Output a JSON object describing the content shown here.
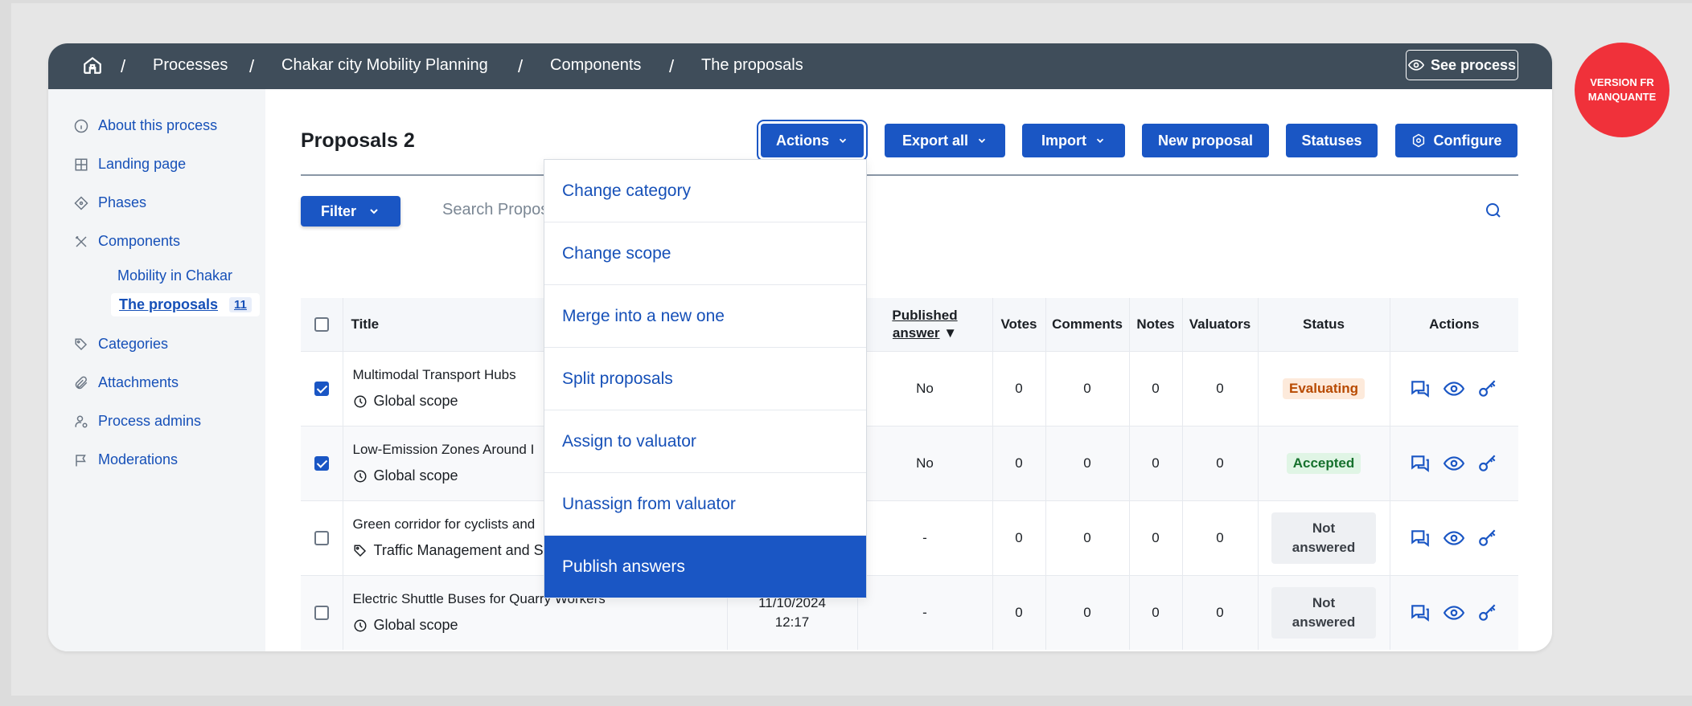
{
  "breadcrumb": {
    "items": [
      "Processes",
      "Chakar city Mobility Planning",
      "Components",
      "The proposals"
    ],
    "see_process": "See process"
  },
  "sidebar": {
    "items": [
      {
        "label": "About this process",
        "icon": "info-icon"
      },
      {
        "label": "Landing page",
        "icon": "layout-icon"
      },
      {
        "label": "Phases",
        "icon": "phases-icon"
      },
      {
        "label": "Components",
        "icon": "tools-icon"
      },
      {
        "label": "Categories",
        "icon": "tag-icon"
      },
      {
        "label": "Attachments",
        "icon": "attachment-icon"
      },
      {
        "label": "Process admins",
        "icon": "admin-icon"
      },
      {
        "label": "Moderations",
        "icon": "flag-icon"
      }
    ],
    "subitems": [
      {
        "label": "Mobility in Chakar"
      },
      {
        "label": "The proposals",
        "count": "11"
      }
    ]
  },
  "main": {
    "title": "Proposals 2",
    "buttons": {
      "actions": "Actions",
      "export_all": "Export all",
      "import": "Import",
      "new_proposal": "New proposal",
      "statuses": "Statuses",
      "configure": "Configure"
    },
    "filter": "Filter",
    "search_placeholder": "Search Propos"
  },
  "dropdown": {
    "items": [
      "Change category",
      "Change scope",
      "Merge into a new one",
      "Split proposals",
      "Assign to valuator",
      "Unassign from valuator",
      "Publish answers"
    ],
    "active_index": 6
  },
  "table": {
    "headers": {
      "title": "Title",
      "published_answer_1": "Published",
      "published_answer_2": "answer",
      "votes": "Votes",
      "comments": "Comments",
      "notes": "Notes",
      "valuators": "Valuators",
      "status": "Status",
      "actions": "Actions"
    },
    "rows": [
      {
        "checked": true,
        "title": "Multimodal Transport Hubs",
        "scope": "Global scope",
        "date": "",
        "time": "",
        "published_answer": "No",
        "votes": "0",
        "comments": "0",
        "notes": "0",
        "valuators": "0",
        "status": "Evaluating",
        "status_color": "#b84a00"
      },
      {
        "checked": true,
        "title": "Low-Emission Zones Around I",
        "scope": "Global scope",
        "date": "",
        "time": "",
        "published_answer": "No",
        "votes": "0",
        "comments": "0",
        "notes": "0",
        "valuators": "0",
        "status": "Accepted",
        "status_color": "#16712d"
      },
      {
        "checked": false,
        "title": "Green corridor for cyclists and",
        "scope": "Traffic Management and S",
        "date": "",
        "time": "",
        "published_answer": "-",
        "votes": "0",
        "comments": "0",
        "notes": "0",
        "valuators": "0",
        "status_1": "Not",
        "status_2": "answered"
      },
      {
        "checked": false,
        "title": "Electric Shuttle Buses for Quarry Workers",
        "scope": "Global scope",
        "date": "11/10/2024",
        "time": "12:17",
        "published_answer": "-",
        "votes": "0",
        "comments": "0",
        "notes": "0",
        "valuators": "0",
        "status_1": "Not",
        "status_2": "answered"
      }
    ]
  },
  "version_badge": {
    "line1": "VERSION FR",
    "line2": "MANQUANTE"
  },
  "colors": {
    "primary": "#1a56c4",
    "topbar": "#3f4d5a",
    "badge": "#f0313a"
  }
}
